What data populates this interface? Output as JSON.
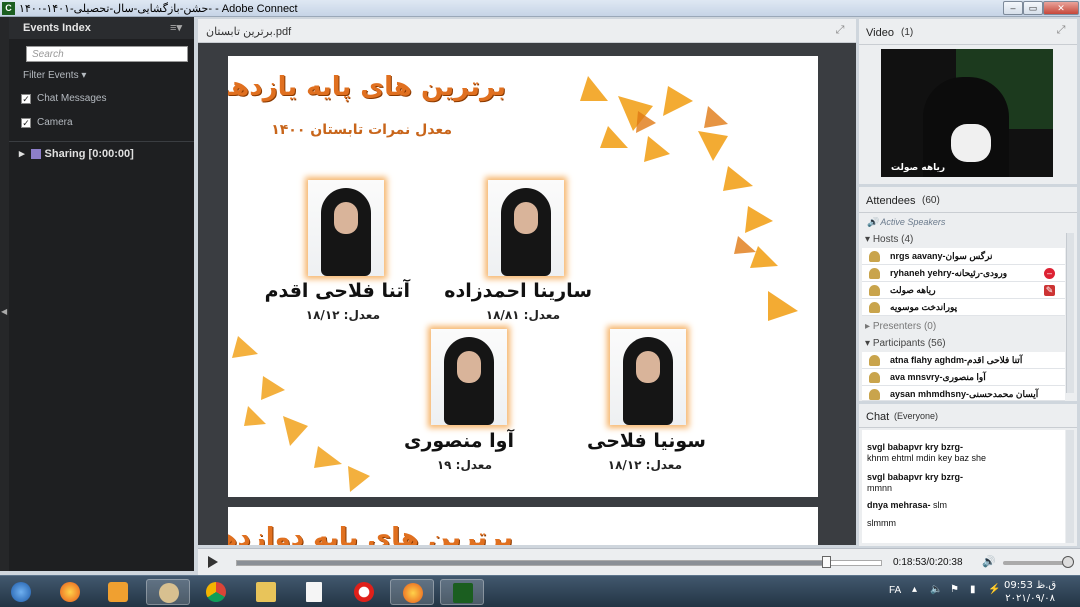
{
  "window": {
    "title": "حشن-بازگشایی-سال-تحصیلی-۱۴۰۱-۱۴۰۰- - Adobe Connect",
    "app_icon_letter": "C"
  },
  "events": {
    "title": "Events Index",
    "search_placeholder": "Search",
    "filter_label": "Filter Events",
    "chat_messages_label": "Chat Messages",
    "camera_label": "Camera",
    "sharing_label": "Sharing [0:00:00]"
  },
  "share": {
    "file_name": "برترین تابستان.pdf",
    "slide": {
      "title": "برترین های پایه یازدهم",
      "subtitle": "معدل نمرات تابستان ۱۴۰۰",
      "students": [
        {
          "name": "آتنا فلاحی اقدم",
          "average": "معدل: ۱۸/۱۲"
        },
        {
          "name": "سارینا احمدزاده",
          "average": "معدل: ۱۸/۸۱"
        },
        {
          "name": "آوا منصوری",
          "average": "معدل: ۱۹"
        },
        {
          "name": "سونیا فلاحی",
          "average": "معدل: ۱۸/۱۲"
        }
      ],
      "next_title": "برترین های پایه دوازدهم"
    }
  },
  "video": {
    "title": "Video",
    "count": "(1)",
    "camera_label": "ریاهه صولت"
  },
  "attendees": {
    "title": "Attendees",
    "count": "(60)",
    "active_speakers": "Active Speakers",
    "hosts_label": "Hosts (4)",
    "hosts": [
      {
        "name": "nrgs aavany-نرگس سوان"
      },
      {
        "name": "ryhaneh yehry-ورودی-رئیحانه"
      },
      {
        "name": "ریاهه صولت"
      },
      {
        "name": "پوراندخت موسویه"
      }
    ],
    "presenters_label": "Presenters (0)",
    "participants_label": "Participants (56)",
    "participants": [
      {
        "name": "atna flahy aghdm-آتنا فلاحی اقدم"
      },
      {
        "name": "ava mnsvry-آوا منصوری"
      },
      {
        "name": "aysan mhmdhsny-آیسان محمدحسنی"
      }
    ]
  },
  "chat": {
    "title": "Chat",
    "scope": "(Everyone)",
    "messages": [
      {
        "sender": "svgl babapvr kry bzrg-",
        "text": "khnm ehtml mdin key baz she"
      },
      {
        "sender": "svgl babapvr kry bzrg-",
        "text": "mmnn"
      },
      {
        "sender": "dnya mehrasa-",
        "text": "slm"
      },
      {
        "sender": "",
        "text": "slmmm"
      }
    ]
  },
  "player": {
    "time": "0:18:53/0:20:38",
    "progress": 0.915,
    "volume": 0.85
  },
  "tray": {
    "lang": "FA",
    "time": "ق.ظ 09:53",
    "date": "۲۰۲۱/۰۹/۰۸"
  }
}
